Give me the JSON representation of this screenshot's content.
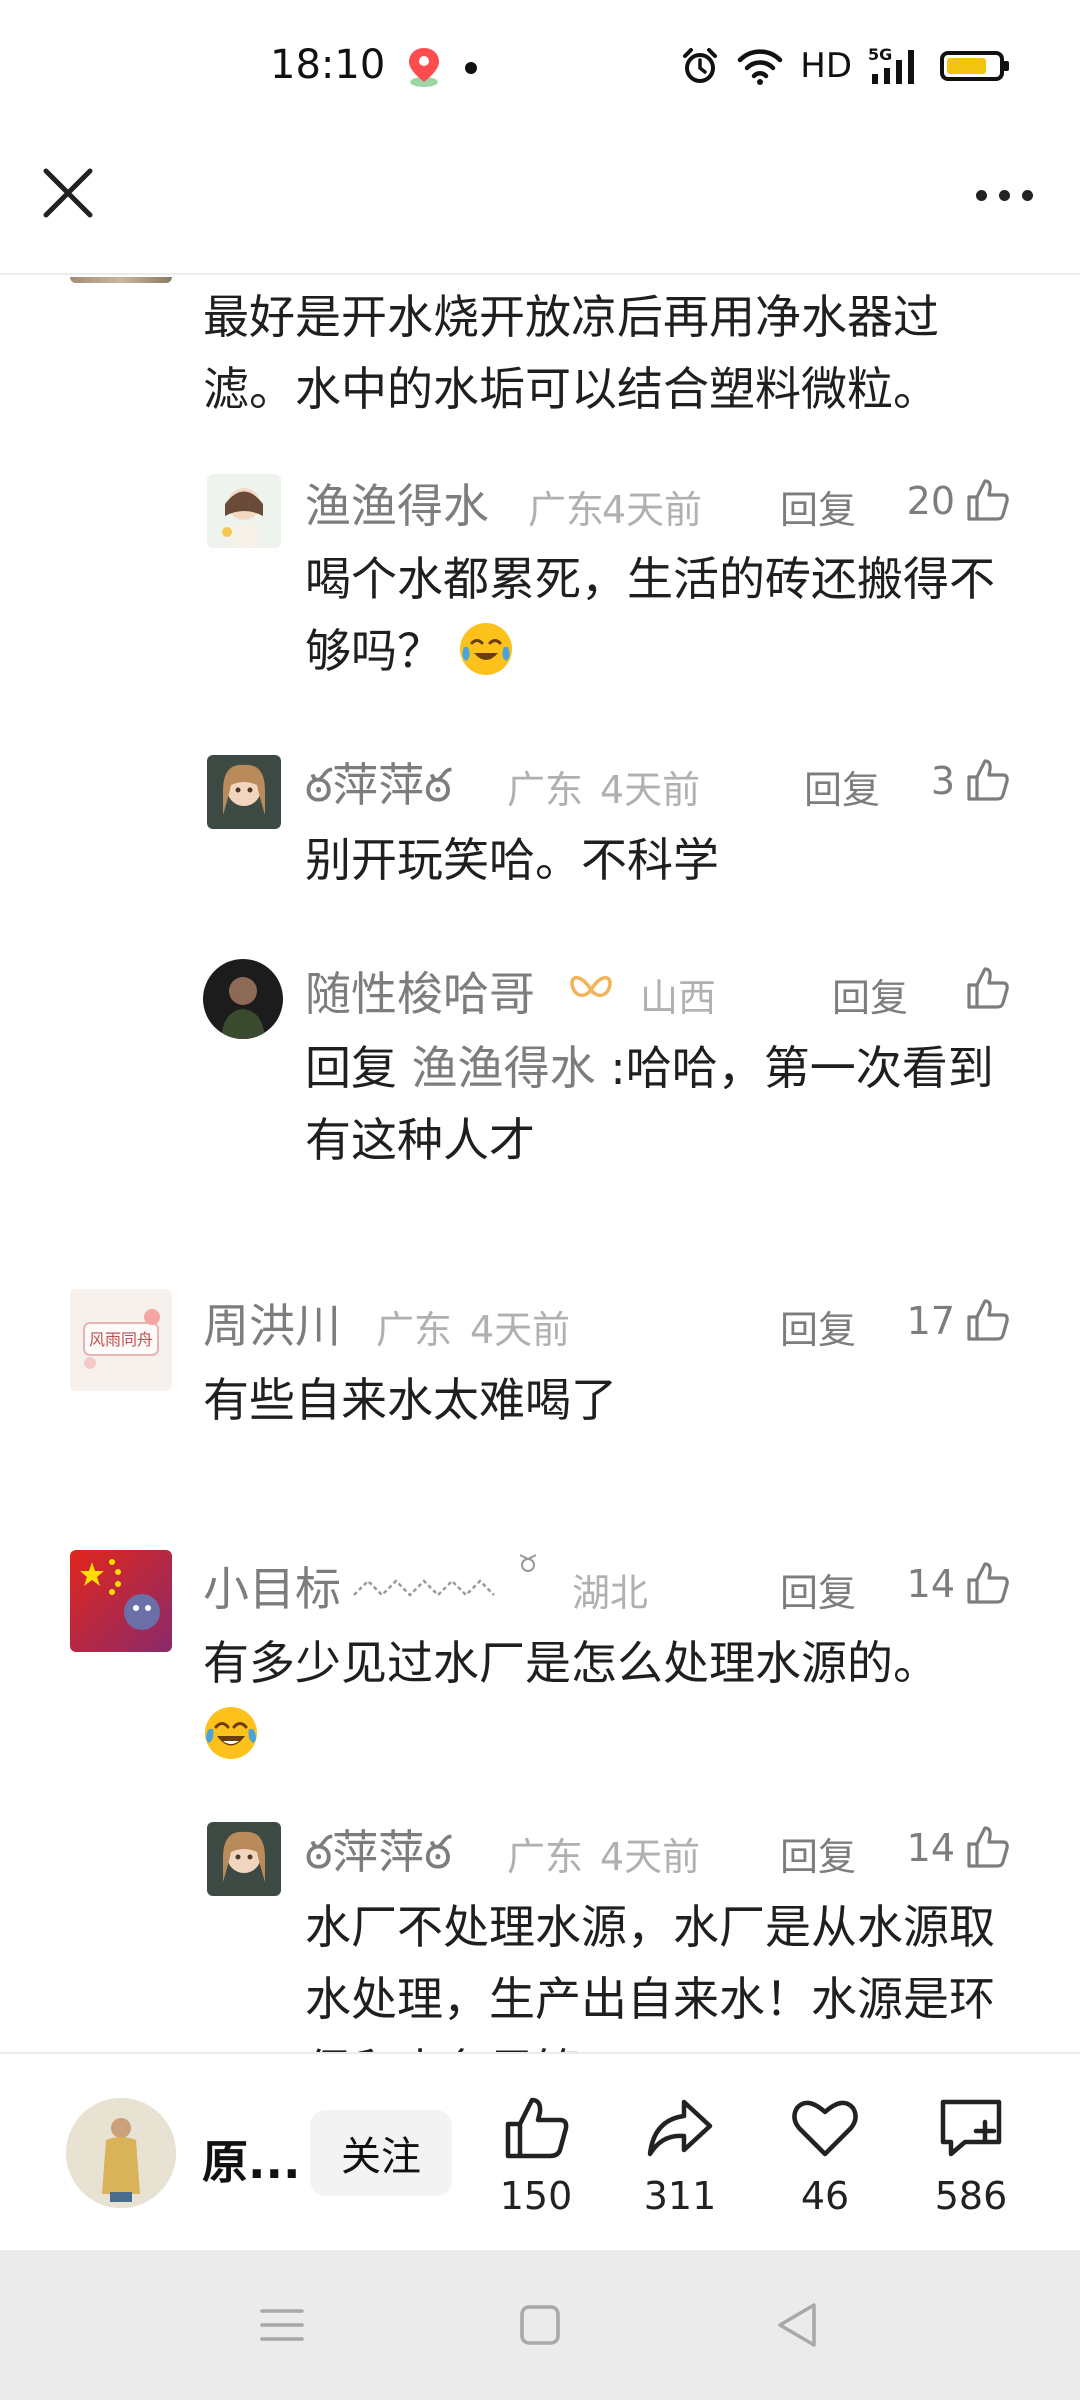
{
  "status_bar": {
    "time": "18:10",
    "network": "HD",
    "signal": "5G",
    "battery_level": 0.7,
    "battery_color": "#f2c40f"
  },
  "header": {
    "close_icon": "close-icon",
    "more_icon": "more-horizontal-icon"
  },
  "comments": {
    "top_fragment": {
      "text": "最好是开水烧开放凉后再用净水器过滤。水中的水垢可以结合塑料微粒。"
    },
    "reply1": {
      "name": "渔渔得水",
      "location": "广东",
      "time": "4天前",
      "reply_label": "回复",
      "likes": "20",
      "text": "喝个水都累死，生活的砖还搬得不够吗？",
      "emoji": "crying-laughing-emoji"
    },
    "reply2": {
      "name": "ఠ萍萍ఠ",
      "location": "广东",
      "time": "4天前",
      "reply_label": "回复",
      "likes": "3",
      "text": "别开玩笑哈。不科学"
    },
    "reply3": {
      "name": "随性梭哈哥",
      "location": "山西",
      "reply_label": "回复",
      "likes": "",
      "reply_prefix": "回复",
      "reply_to": "渔渔得水",
      "text": ":哈哈，第一次看到有这种人才"
    },
    "comment2": {
      "name": "周洪川",
      "location": "广东",
      "time": "4天前",
      "reply_label": "回复",
      "likes": "17",
      "text": "有些自来水太难喝了"
    },
    "comment3": {
      "name": "小目标",
      "location": "湖北",
      "reply_label": "回复",
      "likes": "14",
      "text": "有多少见过水厂是怎么处理水源的。",
      "emoji": "tears-of-joy-emoji"
    },
    "reply4": {
      "name": "ఠ萍萍ఠ",
      "location": "广东",
      "time": "4天前",
      "reply_label": "回复",
      "likes": "14",
      "text": "水厂不处理水源，水厂是从水源取水处理，生产出自来水！水源是环保和水务局管"
    }
  },
  "bottom_bar": {
    "author_name": "原...",
    "follow_label": "关注",
    "like_count": "150",
    "share_count": "311",
    "favorite_count": "46",
    "comment_count": "586"
  },
  "nav_bar": {
    "menu_icon": "menu-icon",
    "home_icon": "home-square-icon",
    "back_icon": "back-triangle-icon"
  }
}
